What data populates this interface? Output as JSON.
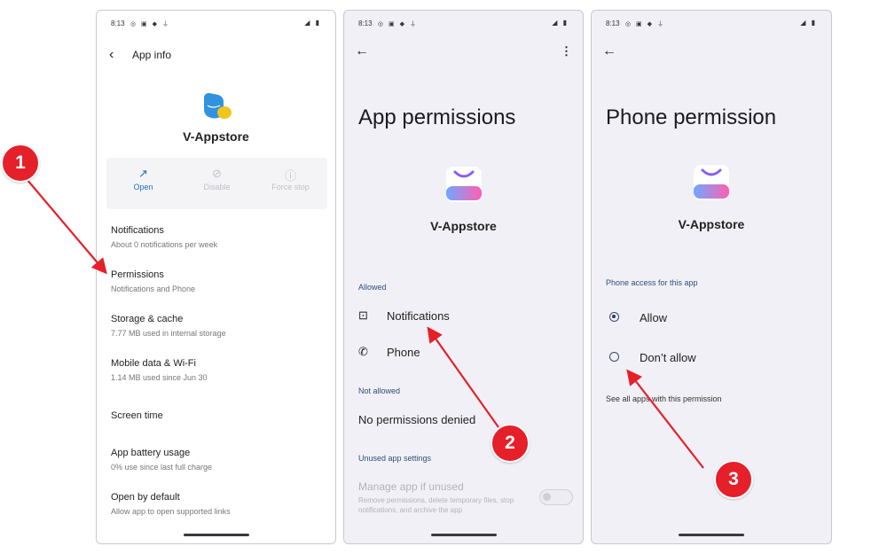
{
  "status": {
    "time": "8:13"
  },
  "screen1": {
    "header_title": "App info",
    "app_name": "V-Appstore",
    "actions": [
      {
        "label": "Open",
        "enabled": true
      },
      {
        "label": "Disable",
        "enabled": false
      },
      {
        "label": "Force stop",
        "enabled": false
      }
    ],
    "rows": [
      {
        "title": "Notifications",
        "subtitle": "About 0 notifications per week"
      },
      {
        "title": "Permissions",
        "subtitle": "Notifications and Phone"
      },
      {
        "title": "Storage & cache",
        "subtitle": "7.77 MB used in internal storage"
      },
      {
        "title": "Mobile data & Wi-Fi",
        "subtitle": "1.14 MB used since Jun 30"
      },
      {
        "title": "Screen time",
        "subtitle": ""
      },
      {
        "title": "App battery usage",
        "subtitle": "0% use since last full charge"
      },
      {
        "title": "Open by default",
        "subtitle": "Allow app to open supported links"
      }
    ]
  },
  "screen2": {
    "title": "App permissions",
    "app_name": "V-Appstore",
    "allowed_label": "Allowed",
    "allowed": [
      "Notifications",
      "Phone"
    ],
    "not_allowed_label": "Not allowed",
    "not_allowed_text": "No permissions denied",
    "unused_label": "Unused app settings",
    "manage_title": "Manage app if unused",
    "manage_desc": "Remove permissions, delete temporary files, stop notifications, and archive the app",
    "manage_enabled": false
  },
  "screen3": {
    "title": "Phone permission",
    "app_name": "V-Appstore",
    "section_label": "Phone access for this app",
    "options": [
      {
        "label": "Allow",
        "selected": true
      },
      {
        "label": "Don’t allow",
        "selected": false
      }
    ],
    "link": "See all apps with this permission"
  },
  "annotations": {
    "steps": [
      "1",
      "2",
      "3"
    ],
    "color": "#e5202b"
  }
}
